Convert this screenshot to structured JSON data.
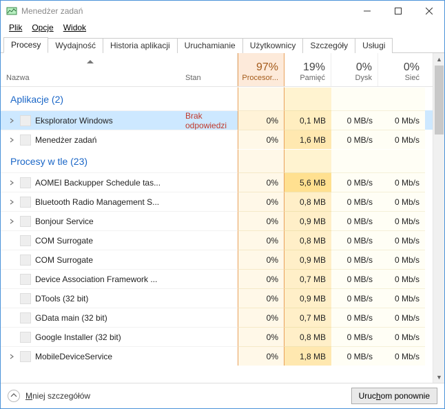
{
  "window": {
    "title": "Menedżer zadań"
  },
  "menu": {
    "file": "Plik",
    "options": "Opcje",
    "view": "Widok"
  },
  "tabs": [
    {
      "label": "Procesy",
      "active": true
    },
    {
      "label": "Wydajność",
      "active": false
    },
    {
      "label": "Historia aplikacji",
      "active": false
    },
    {
      "label": "Uruchamianie",
      "active": false
    },
    {
      "label": "Użytkownicy",
      "active": false
    },
    {
      "label": "Szczegóły",
      "active": false
    },
    {
      "label": "Usługi",
      "active": false
    }
  ],
  "columns": {
    "name": "Nazwa",
    "status": "Stan",
    "cpu": {
      "value": "97%",
      "label": "Procesor..."
    },
    "mem": {
      "value": "19%",
      "label": "Pamięć"
    },
    "disk": {
      "value": "0%",
      "label": "Dysk"
    },
    "net": {
      "value": "0%",
      "label": "Sieć"
    }
  },
  "sections": [
    {
      "title": "Aplikacje (2)",
      "rows": [
        {
          "expandable": true,
          "selected": true,
          "name": "Eksplorator Windows",
          "status": "Brak odpowiedzi",
          "cpu": "0%",
          "mem": "0,1 MB",
          "disk": "0 MB/s",
          "net": "0 Mb/s",
          "heat": 0
        },
        {
          "expandable": true,
          "selected": false,
          "name": "Menedżer zadań",
          "status": "",
          "cpu": "0%",
          "mem": "1,6 MB",
          "disk": "0 MB/s",
          "net": "0 Mb/s",
          "heat": 1
        }
      ]
    },
    {
      "title": "Procesy w tle (23)",
      "rows": [
        {
          "expandable": true,
          "selected": false,
          "name": "AOMEI Backupper Schedule tas...",
          "status": "",
          "cpu": "0%",
          "mem": "5,6 MB",
          "disk": "0 MB/s",
          "net": "0 Mb/s",
          "heat": 2
        },
        {
          "expandable": true,
          "selected": false,
          "name": "Bluetooth Radio Management S...",
          "status": "",
          "cpu": "0%",
          "mem": "0,8 MB",
          "disk": "0 MB/s",
          "net": "0 Mb/s",
          "heat": 0
        },
        {
          "expandable": true,
          "selected": false,
          "name": "Bonjour Service",
          "status": "",
          "cpu": "0%",
          "mem": "0,9 MB",
          "disk": "0 MB/s",
          "net": "0 Mb/s",
          "heat": 0
        },
        {
          "expandable": false,
          "selected": false,
          "name": "COM Surrogate",
          "status": "",
          "cpu": "0%",
          "mem": "0,8 MB",
          "disk": "0 MB/s",
          "net": "0 Mb/s",
          "heat": 0
        },
        {
          "expandable": false,
          "selected": false,
          "name": "COM Surrogate",
          "status": "",
          "cpu": "0%",
          "mem": "0,9 MB",
          "disk": "0 MB/s",
          "net": "0 Mb/s",
          "heat": 0
        },
        {
          "expandable": false,
          "selected": false,
          "name": "Device Association Framework ...",
          "status": "",
          "cpu": "0%",
          "mem": "0,7 MB",
          "disk": "0 MB/s",
          "net": "0 Mb/s",
          "heat": 0
        },
        {
          "expandable": false,
          "selected": false,
          "name": "DTools (32 bit)",
          "status": "",
          "cpu": "0%",
          "mem": "0,9 MB",
          "disk": "0 MB/s",
          "net": "0 Mb/s",
          "heat": 0
        },
        {
          "expandable": false,
          "selected": false,
          "name": "GData main (32 bit)",
          "status": "",
          "cpu": "0%",
          "mem": "0,7 MB",
          "disk": "0 MB/s",
          "net": "0 Mb/s",
          "heat": 0
        },
        {
          "expandable": false,
          "selected": false,
          "name": "Google Installer (32 bit)",
          "status": "",
          "cpu": "0%",
          "mem": "0,8 MB",
          "disk": "0 MB/s",
          "net": "0 Mb/s",
          "heat": 0
        },
        {
          "expandable": true,
          "selected": false,
          "name": "MobileDeviceService",
          "status": "",
          "cpu": "0%",
          "mem": "1,8 MB",
          "disk": "0 MB/s",
          "net": "0 Mb/s",
          "heat": 1
        }
      ]
    }
  ],
  "footer": {
    "fewer": "Mniej szczegółów",
    "action": "Uruchom ponownie"
  }
}
